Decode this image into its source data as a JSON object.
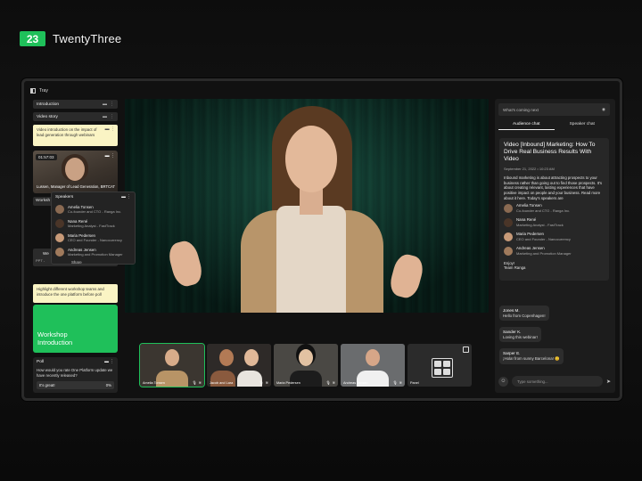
{
  "brand": {
    "logo": "23",
    "name": "TwentyThree"
  },
  "tray": {
    "label": "Tray"
  },
  "left": {
    "introduction": "Introduction",
    "video_story": "Video story",
    "note1": "Video introduction on the impact of lead generation through webinars",
    "video_time": "01:57:03",
    "video_caption": "Lussen, Manager of Lead Generation, BRTCAT",
    "workshop_chip": "Worksh",
    "speakers_title": "Speakers",
    "share": "Share",
    "we_chip": "We",
    "ppt": "PPT -",
    "note2": "Highlight different workshop teams and introduce the one platform before poll",
    "green_card": "Workshop Introduction",
    "poll_title": "Poll",
    "poll_question": "How would you rate One Platform update we have recently released?",
    "poll_answer": "It's great!",
    "poll_percent": "0%"
  },
  "speakers": [
    {
      "name": "Amelia Tonsen",
      "role": "Co-founder and CTO - Ranga Inc.",
      "color": "#8a6a52"
    },
    {
      "name": "Nana René",
      "role": "Marketing Analyst - FastTrack",
      "color": "#4a3528"
    },
    {
      "name": "Maria Pedersen",
      "role": "CEO and Founder - Nanocurrency",
      "color": "#c89a78"
    },
    {
      "name": "Andreas Jensen",
      "role": "Marketing and Promotion Manager",
      "color": "#a07a5c"
    }
  ],
  "participants": [
    {
      "name": "Amelia Tonsen",
      "bg": "#3b3630",
      "skin": "#d8ac8a",
      "shirt": "#b89466",
      "active": true
    },
    {
      "name": "Jacob and Lara",
      "bg": "#2e2a28",
      "skin": "#b27a55",
      "shirt": "#e8e4de",
      "active": false
    },
    {
      "name": "Maria Pedersen",
      "bg": "#4a4844",
      "skin": "#e2c2a2",
      "shirt": "#1c1c1c",
      "active": false
    },
    {
      "name": "Andreas Jensen",
      "bg": "#6a6c6e",
      "skin": "#d6a688",
      "shirt": "#f0f0f0",
      "active": false
    }
  ],
  "panel_label": "Panel",
  "right": {
    "whats_next": "What's coming next",
    "tab_audience": "Audience chat",
    "tab_speaker": "Speaker chat",
    "post_title": "Video [Inbound] Marketing: How To Drive Real Business Results With Video",
    "post_date": "September 21, 2022 • 10:23 AM",
    "post_body": "Inbound marketing is about attracting prospects to your business rather than going out to find those prospects. It's about creating relevant, lasting experiences that have positive impact on people and your business. Read more about it here. Today's speakers are",
    "post_sign1": "Enjoy!",
    "post_sign2": "Team Ranga",
    "messages": [
      {
        "who": "Jones M.",
        "text": "Hello from Copenhagen!"
      },
      {
        "who": "Sander K.",
        "text": "Loving this webinar!"
      },
      {
        "who": "Sarper E.",
        "text": "¡Hola! from sunny Barcelona! 😊"
      }
    ],
    "composer_placeholder": "Type something..."
  },
  "colors": {
    "accent": "#1fc05a",
    "note": "#faf4c4"
  }
}
